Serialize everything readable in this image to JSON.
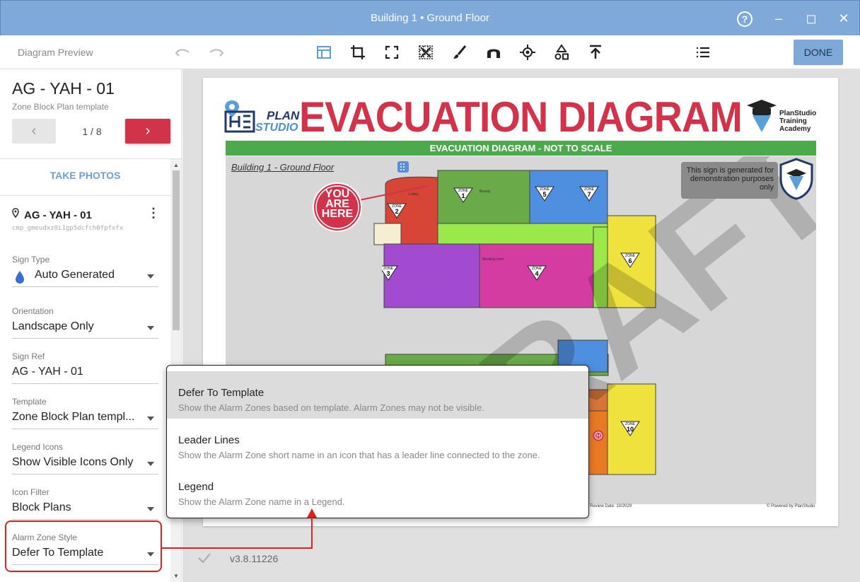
{
  "window": {
    "title": "Building 1 • Ground Floor"
  },
  "toolbar": {
    "preview_label": "Diagram Preview",
    "done_label": "DONE"
  },
  "sidebar": {
    "title": "AG - YAH - 01",
    "subtitle": "Zone Block Plan template",
    "pager": {
      "text": "1 / 8"
    },
    "take_photos_label": "TAKE PHOTOS",
    "item": {
      "name": "AG - YAH - 01",
      "id": "cmp_gmeudxz0i1gp5dcfch0fpfxfx"
    },
    "fields": [
      {
        "label": "Sign Type",
        "value": "Auto Generated"
      },
      {
        "label": "Orientation",
        "value": "Landscape Only"
      },
      {
        "label": "Sign Ref",
        "value": "AG - YAH - 01"
      },
      {
        "label": "Template",
        "value": "Zone Block Plan templ..."
      },
      {
        "label": "Legend Icons",
        "value": "Show Visible Icons Only"
      },
      {
        "label": "Icon Filter",
        "value": "Block Plans"
      },
      {
        "label": "Alarm Zone Style",
        "value": "Defer To Template"
      }
    ]
  },
  "diagram": {
    "title": "EVACUATION DIAGRAM",
    "logo_plan": "PLAN",
    "logo_studio": "STUDIO",
    "logo_right": "PlanStudio Training Academy",
    "banner": "EVACUATION DIAGRAM - NOT TO SCALE",
    "floor_label": "Building 1 - Ground Floor",
    "demo_note": "This sign is generated for demonstration purposes only",
    "you_are_here": "YOU ARE HERE",
    "watermark": "DRAFT",
    "zones": [
      {
        "label": "ZONE",
        "number": "1"
      },
      {
        "label": "ZONE",
        "number": "2"
      },
      {
        "label": "ZONE",
        "number": "3"
      },
      {
        "label": "ZONE",
        "number": "4"
      },
      {
        "label": "ZONE",
        "number": "5"
      },
      {
        "label": "ZONE",
        "number": "6"
      },
      {
        "label": "ZONE",
        "number": "7"
      },
      {
        "label": "ZONE",
        "number": "10"
      }
    ],
    "room_labels": {
      "lobby": "Lobby",
      "beauty": "Beauty",
      "meeting": "Meeting room"
    },
    "footer_left": "Review Date: 10/2029",
    "footer_right": "© Powered by PlanStudio"
  },
  "menu": {
    "items": [
      {
        "title": "Defer To Template",
        "desc": "Show the Alarm Zones based on template. Alarm Zones may not be visible.",
        "selected": true
      },
      {
        "title": "Leader Lines",
        "desc": "Show the Alarm Zone short name in an icon that has a leader line connected to the zone."
      },
      {
        "title": "Legend",
        "desc": "Show the Alarm Zone name in a Legend."
      }
    ]
  },
  "status": {
    "version": "v3.8.11226"
  },
  "colors": {
    "titlebar": "#7ea9d8",
    "accent_red": "#d0334a",
    "accent_blue": "#6f9fd0",
    "banner_green": "#4caa4c"
  }
}
